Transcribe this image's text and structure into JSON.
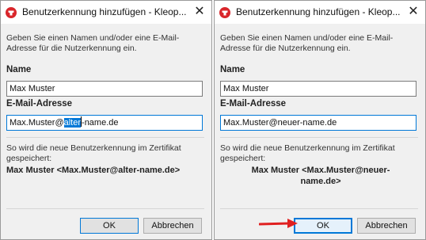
{
  "left_dialog": {
    "title": "Benutzerkennung hinzufügen - Kleop...",
    "close_glyph": "✕",
    "description": "Geben Sie einen Namen und/oder eine E-Mail-Adresse für die Nutzerkennung ein.",
    "name_label": "Name",
    "name_value": "Max Muster",
    "email_label": "E-Mail-Adresse",
    "email_before": "Max.Muster@",
    "email_selected": "alter",
    "email_after": "-name.de",
    "preview_intro": "So wird die neue Benutzerkennung im Zertifikat gespeichert:",
    "preview_value": "Max Muster <Max.Muster@alter-name.de>",
    "ok_label": "OK",
    "cancel_label": "Abbrechen"
  },
  "right_dialog": {
    "title": "Benutzerkennung hinzufügen - Kleop...",
    "close_glyph": "✕",
    "description": "Geben Sie einen Namen und/oder eine E-Mail-Adresse für die Nutzerkennung ein.",
    "name_label": "Name",
    "name_value": "Max Muster",
    "email_label": "E-Mail-Adresse",
    "email_value": "Max.Muster@neuer-name.de",
    "preview_intro": "So wird die neue Benutzerkennung im Zertifikat gespeichert:",
    "preview_line1": "Max Muster <Max.Muster@neuer-",
    "preview_line2": "name.de>",
    "ok_label": "OK",
    "cancel_label": "Abbrechen"
  },
  "icons": {
    "app": "kleopatra-icon",
    "close": "close-icon",
    "annotation": "red-arrow-icon"
  },
  "colors": {
    "focus_blue": "#0078d7",
    "app_icon_red": "#d9262b",
    "arrow_red": "#e02020"
  }
}
